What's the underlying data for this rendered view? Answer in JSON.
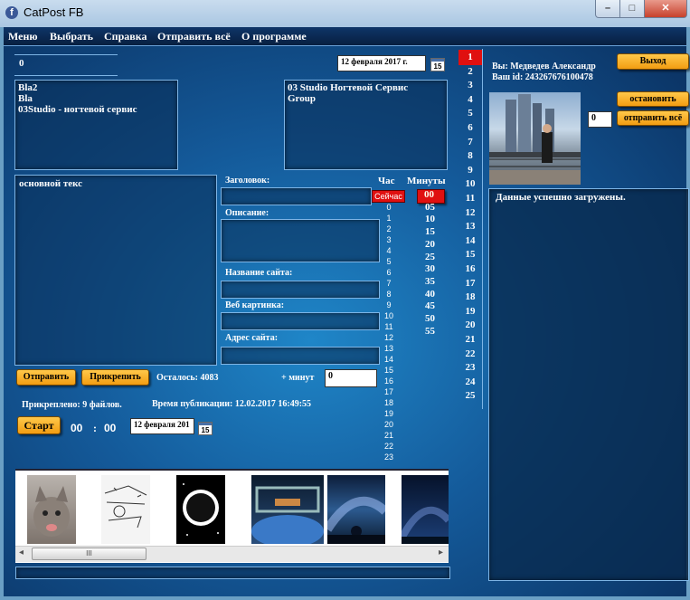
{
  "window": {
    "title": "CatPost FB",
    "minimize": "–",
    "maximize": "□",
    "close": "✕"
  },
  "menu": [
    "Меню",
    "Выбрать",
    "Справка",
    "Отправить всё",
    "О программе"
  ],
  "top_counter": "0",
  "date_top": "12 февраля 2017 г.",
  "calendar_day": "15",
  "groups_left": [
    "Bla2",
    "Bla",
    "03Studio - ногтевой сервис"
  ],
  "groups_right": [
    "03 Studio Ногтевой Сервис",
    "Group"
  ],
  "main_text": "основной текс",
  "fields": {
    "title_label": "Заголовок:",
    "desc_label": "Описание:",
    "site_name_label": "Название сайта:",
    "web_image_label": "Веб картинка:",
    "site_address_label": "Адрес сайта:"
  },
  "buttons": {
    "send": "Отправить",
    "attach": "Прикрепить",
    "start": "Старт",
    "exit": "Выход",
    "stop": "остановить",
    "send_all": "отправить всё"
  },
  "remaining": "Осталось: 4083",
  "plus_minutes_label": "+ минут",
  "plus_minutes_value": "0",
  "attached": "Прикреплено: 9 файлов.",
  "publish_time": "Время публикации: 12.02.2017 16:49:55",
  "timer": {
    "hours": "00",
    "sep": ":",
    "minutes": "00"
  },
  "date_bottom": "12 февраля 201",
  "schedule": {
    "hour_label": "Час",
    "minutes_label": "Минуты",
    "now_button": "Сейчас",
    "hours": [
      "0",
      "1",
      "2",
      "3",
      "4",
      "5",
      "6",
      "7",
      "8",
      "9",
      "10",
      "11",
      "12",
      "13",
      "14",
      "15",
      "16",
      "17",
      "18",
      "19",
      "20",
      "21",
      "22",
      "23"
    ],
    "minutes": [
      "00",
      "05",
      "10",
      "15",
      "20",
      "25",
      "30",
      "35",
      "40",
      "45",
      "50",
      "55"
    ],
    "selected_minute": "00"
  },
  "day_list": [
    "1",
    "2",
    "3",
    "4",
    "5",
    "6",
    "7",
    "8",
    "9",
    "10",
    "11",
    "12",
    "13",
    "14",
    "15",
    "16",
    "17",
    "18",
    "19",
    "20",
    "21",
    "22",
    "23",
    "24",
    "25"
  ],
  "selected_day": "1",
  "user": {
    "name_line": "Вы: Медведев Александр",
    "id_line": "Ваш id: 243267676100478"
  },
  "right_counter": "0",
  "status": "Данные успешно загружены.",
  "images": [
    "cat-photo",
    "sketch-photo",
    "space-circle-photo",
    "iss-earth-photo",
    "milky-way-tree-photo",
    "night-sky-photo"
  ],
  "scrollbar": {
    "left_arrow": "◂",
    "right_arrow": "▸",
    "grip": "III"
  },
  "colors": {
    "accent_orange": "#f29d12",
    "selected_red": "#e01010",
    "panel_border": "#7eb5e6"
  }
}
